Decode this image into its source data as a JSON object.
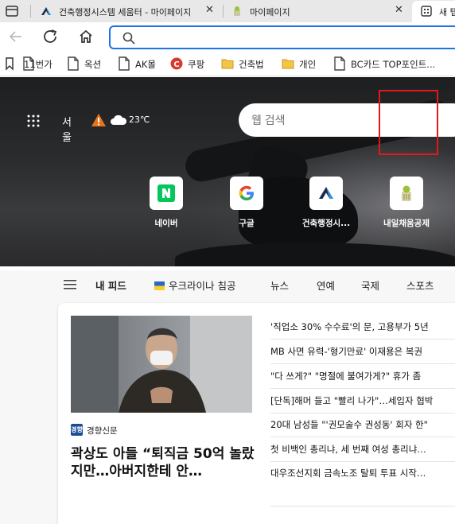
{
  "browser": {
    "tabs": [
      {
        "title": "건축행정시스템 세움터 - 마이페이지",
        "active": false
      },
      {
        "title": "마이페이지",
        "active": false
      },
      {
        "title": "새 탭",
        "active": true
      }
    ],
    "address": {
      "value": "",
      "placeholder": ""
    },
    "bookmarks": [
      {
        "label": "11번가",
        "icon": "page-icon"
      },
      {
        "label": "옥션",
        "icon": "page-icon"
      },
      {
        "label": "AK몰",
        "icon": "page-icon"
      },
      {
        "label": "쿠팡",
        "icon": "coupang-icon"
      },
      {
        "label": "건축법",
        "icon": "folder-icon"
      },
      {
        "label": "개인",
        "icon": "folder-icon"
      },
      {
        "label": "BC카드 TOP포인트...",
        "icon": "page-icon"
      }
    ]
  },
  "newtab": {
    "weather": {
      "city": "서울",
      "temp": "23℃"
    },
    "search": {
      "placeholder": "웹 검색"
    },
    "sites": [
      {
        "label": "네이버",
        "icon": "naver-icon"
      },
      {
        "label": "구글",
        "icon": "google-icon"
      },
      {
        "label": "건축행정시...",
        "icon": "seumteo-icon"
      },
      {
        "label": "내일채움공제",
        "icon": "naeil-icon"
      }
    ],
    "highlight_color": "#e2181b"
  },
  "feed": {
    "nav": [
      "내 피드",
      "우크라이나 침공",
      "뉴스",
      "연예",
      "국제",
      "스포츠"
    ],
    "main_story": {
      "source": "경향신문",
      "source_icon_text": "경향",
      "headline": "곽상도 아들 “퇴직금 50억 놀랐지만…아버지한테 안…"
    },
    "headlines": [
      "'직업소 30% 수수료'의 문, 고용부가 5년",
      "MB 사면 유력-'형기만료' 이재용은 복권",
      "\"다 쓰게?\" \"명절에 불여가게?\" 휴가 좀",
      "[단독]해머 들고 \"빨리 나가\"…세입자 협박",
      "20대 남성들 \"'권모술수 권성동' 회자 한\"",
      "첫 비백인 총리냐, 세 번째 여성 총리냐…",
      "대우조선지회 금속노조 탈퇴 투표 시작…"
    ]
  }
}
